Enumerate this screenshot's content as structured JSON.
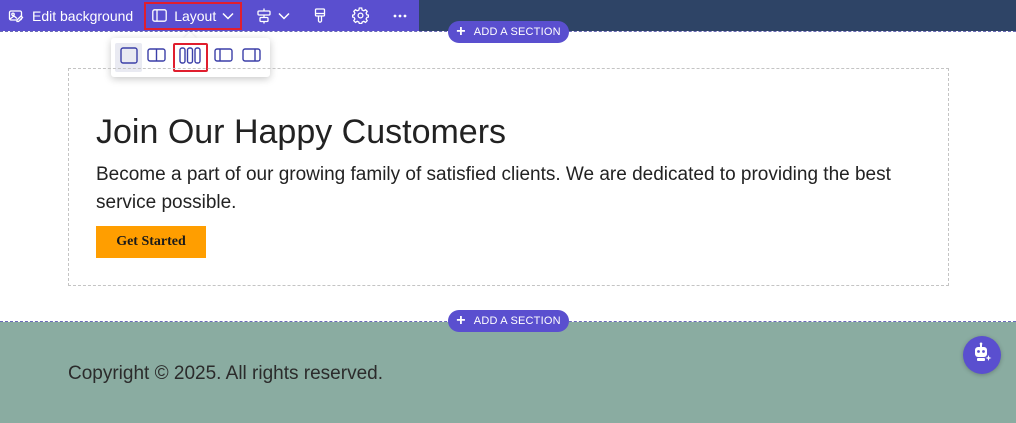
{
  "toolbar": {
    "edit_background_label": "Edit background",
    "layout_label": "Layout",
    "accent_color": "#5a4fcf"
  },
  "layout_options": [
    {
      "name": "one-column",
      "selected": true
    },
    {
      "name": "two-columns"
    },
    {
      "name": "three-columns"
    },
    {
      "name": "left-sidebar"
    },
    {
      "name": "right-sidebar"
    }
  ],
  "add_section": {
    "top_label": "ADD A SECTION",
    "bottom_label": "ADD A SECTION"
  },
  "hero": {
    "title": "Join Our Happy Customers",
    "text": "Become a part of our growing family of satisfied clients. We are dedicated to providing the best service possible.",
    "button_label": "Get Started",
    "button_color": "#ff9e00"
  },
  "footer": {
    "text": "Copyright © 2025. All rights reserved.",
    "background_color": "#8aaca1"
  }
}
